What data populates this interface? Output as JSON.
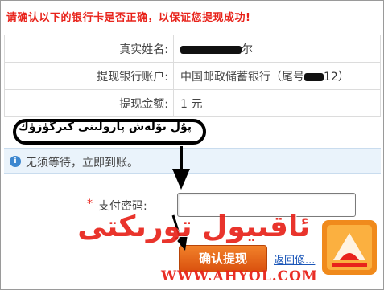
{
  "header": {
    "text": "请确认以下的银行卡是否正确，以保证您提现成功!"
  },
  "table": {
    "rows": [
      {
        "label": "真实姓名:",
        "value_suffix": "尔"
      },
      {
        "label": "提现银行账户:",
        "value_prefix": "中国邮政储蓄银行（尾号",
        "value_suffix": "12）"
      },
      {
        "label": "提现金额:",
        "value": "1 元"
      }
    ]
  },
  "callout": {
    "text": "پۇل تۆلەش پارولىنى كىرگۈزۈڭ"
  },
  "notice": {
    "icon": "info-icon",
    "icon_glyph": "i",
    "text": "无须等待，立即到账。"
  },
  "form": {
    "required_mark": "*",
    "password_label": "支付密码:",
    "password_value": ""
  },
  "actions": {
    "confirm_label": "确认提现",
    "back_label": "返回修..."
  },
  "watermark": {
    "text": "ئاقىيول تورىكتى",
    "url": "WWW.AHYOL.COM",
    "logo_icon": "ahyol-logo-icon"
  },
  "colors": {
    "accent_red": "#e8231b",
    "button_orange": "#e46a1c",
    "notice_bg": "#eaf3fb",
    "link_blue": "#1a56b8"
  }
}
